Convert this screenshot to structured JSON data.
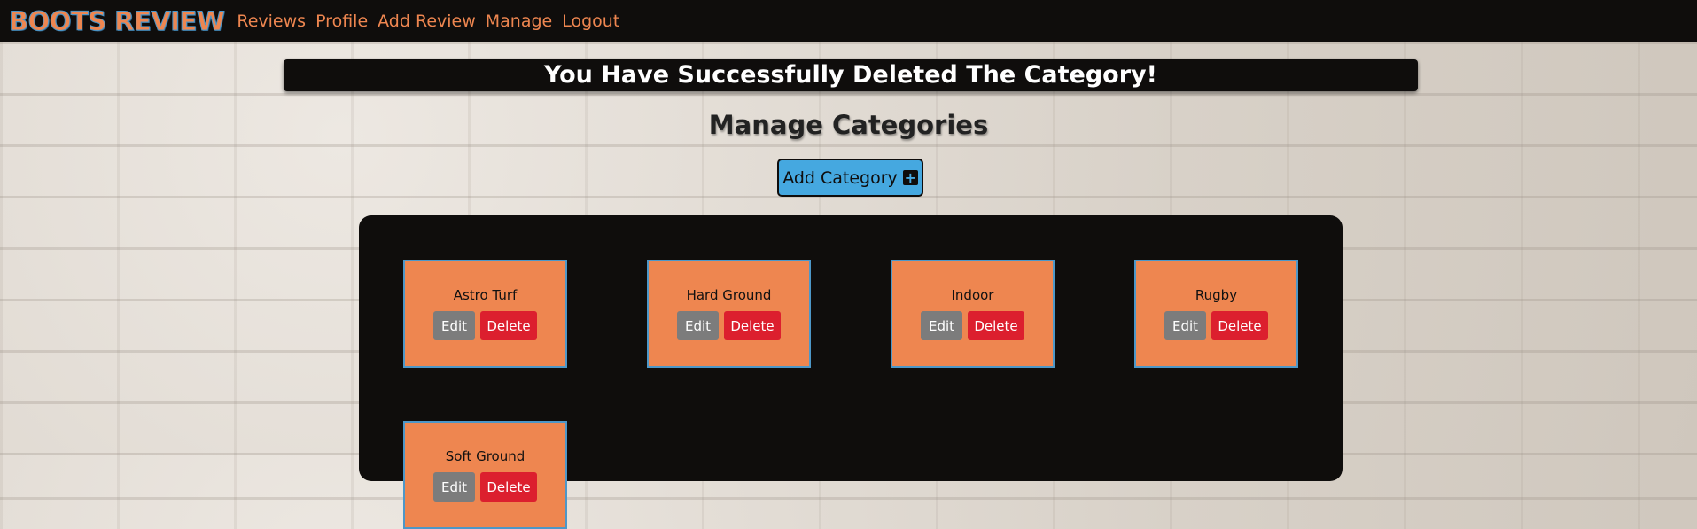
{
  "nav": {
    "brand": "BOOTS REVIEW",
    "links": [
      "Reviews",
      "Profile",
      "Add Review",
      "Manage",
      "Logout"
    ]
  },
  "alert": {
    "message": "You Have Successfully Deleted The Category!"
  },
  "page": {
    "title": "Manage Categories",
    "add_button_label": "Add Category",
    "add_button_icon": "plus-square-icon"
  },
  "categories": [
    {
      "name": "Astro Turf",
      "edit_label": "Edit",
      "delete_label": "Delete"
    },
    {
      "name": "Hard Ground",
      "edit_label": "Edit",
      "delete_label": "Delete"
    },
    {
      "name": "Indoor",
      "edit_label": "Edit",
      "delete_label": "Delete"
    },
    {
      "name": "Rugby",
      "edit_label": "Edit",
      "delete_label": "Delete"
    },
    {
      "name": "Soft Ground",
      "edit_label": "Edit",
      "delete_label": "Delete"
    }
  ],
  "colors": {
    "accent_orange": "#ee8650",
    "button_blue": "#45a8e0",
    "delete_red": "#dc1f2e",
    "edit_gray": "#7c7c7c",
    "dark": "#0f0d0c"
  }
}
